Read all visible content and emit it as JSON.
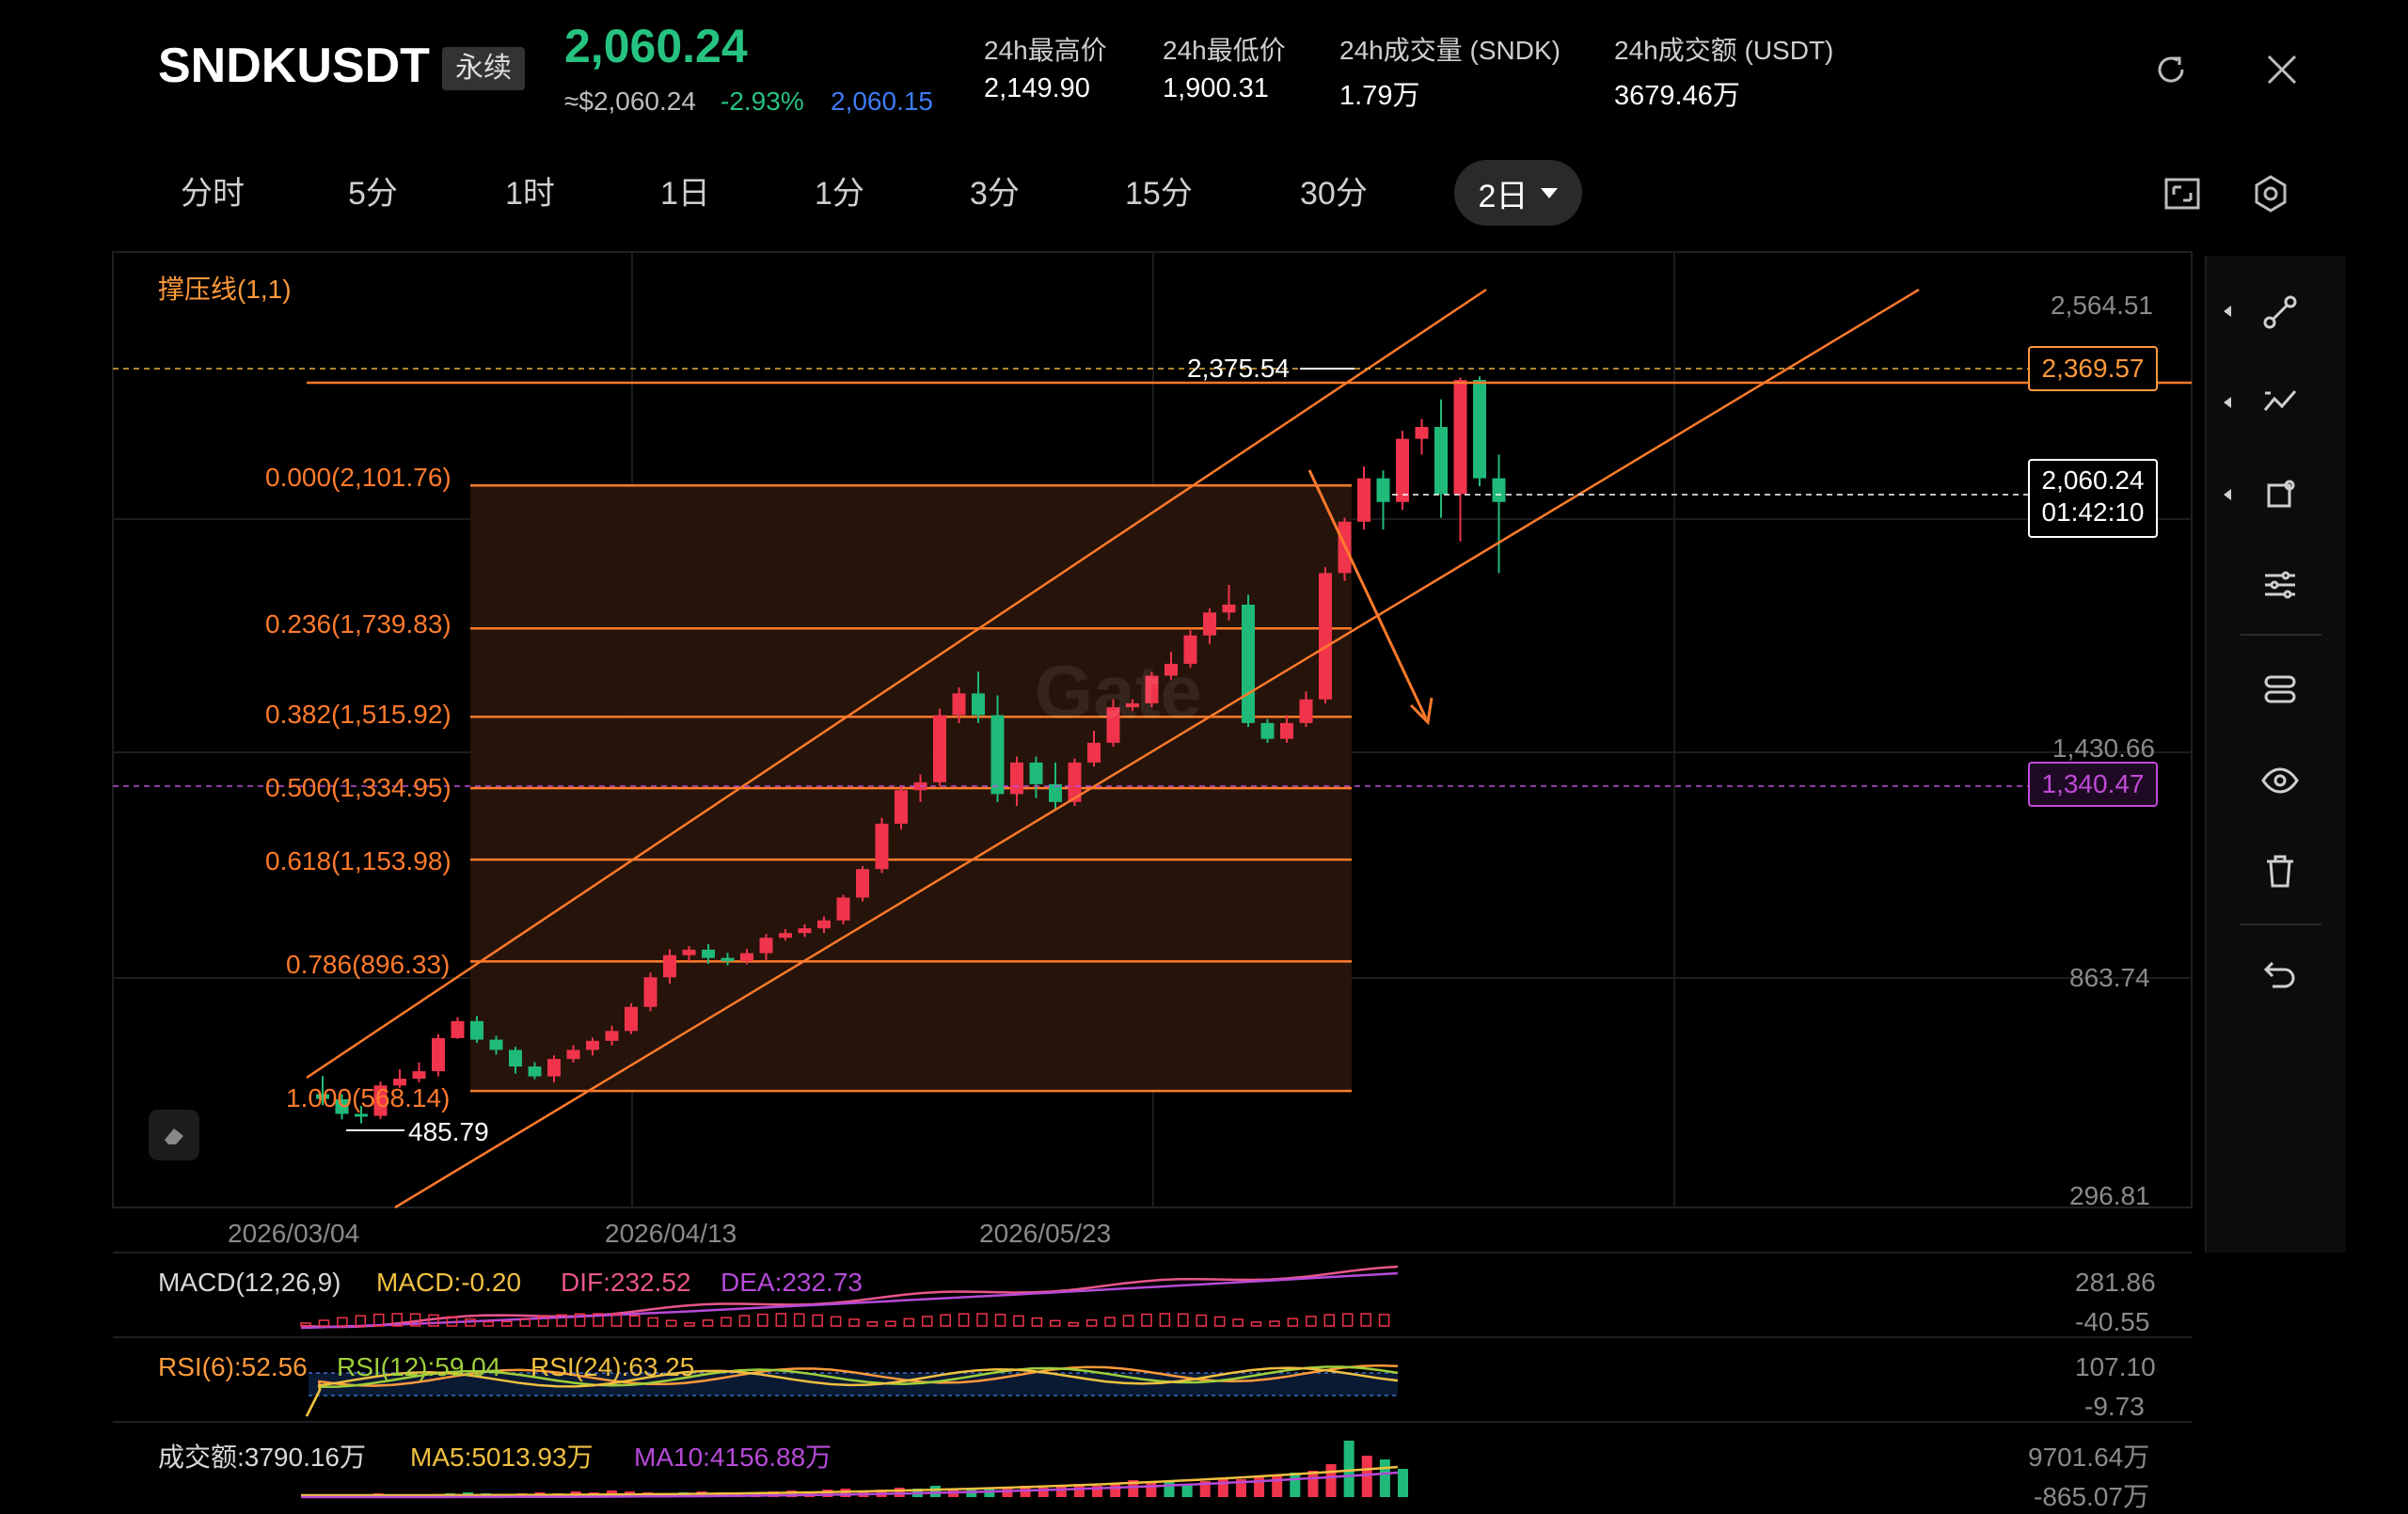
{
  "header": {
    "symbol": "SNDKUSDT",
    "contract_badge": "永续",
    "last_price": "2,060.24",
    "fiat_price": "≈$2,060.24",
    "change_pct": "-2.93%",
    "mark_price": "2,060.15",
    "stats": [
      {
        "label": "24h最高价",
        "value": "2,149.90"
      },
      {
        "label": "24h最低价",
        "value": "1,900.31"
      },
      {
        "label": "24h成交量 (SNDK)",
        "value": "1.79万"
      },
      {
        "label": "24h成交额 (USDT)",
        "value": "3679.46万"
      }
    ]
  },
  "intervals": [
    "分时",
    "5分",
    "1时",
    "1日",
    "1分",
    "3分",
    "15分",
    "30分"
  ],
  "active_interval": "2日",
  "colors": {
    "up": "#f0344c",
    "down": "#1fba7a",
    "fib": "#ff7a2b",
    "magenta": "#c04ad8",
    "price_green": "#26c281",
    "mark_blue": "#3d7cf5",
    "dif": "#e8558c",
    "dea": "#b64ad8",
    "macd_label": "#f0c040",
    "rsi6": "#ff9a3b",
    "rsi12": "#9ecf3b",
    "rsi24": "#f0c040"
  },
  "main_chart": {
    "indicator_label": "撑压线(1,1)",
    "y_ticks": [
      "2,564.51",
      "1,430.66",
      "863.74",
      "296.81"
    ],
    "x_ticks": [
      "2026/03/04",
      "2026/04/13",
      "2026/05/23"
    ],
    "high_marker": "2,375.54",
    "low_marker": "485.79",
    "orange_line_price": "2,369.57",
    "current_price": "2,060.24",
    "countdown": "01:42:10",
    "magenta_line_price": "1,340.47",
    "fib_levels": [
      {
        "label": "0.000(2,101.76)",
        "ratio": 0.0,
        "price": 2101.76
      },
      {
        "label": "0.236(1,739.83)",
        "ratio": 0.236,
        "price": 1739.83
      },
      {
        "label": "0.382(1,515.92)",
        "ratio": 0.382,
        "price": 1515.92
      },
      {
        "label": "0.500(1,334.95)",
        "ratio": 0.5,
        "price": 1334.95
      },
      {
        "label": "0.618(1,153.98)",
        "ratio": 0.618,
        "price": 1153.98
      },
      {
        "label": "0.786(896.33)",
        "ratio": 0.786,
        "price": 896.33
      },
      {
        "label": "1.000(568.14)",
        "ratio": 1.0,
        "price": 568.14
      }
    ],
    "watermark": "Gate"
  },
  "candles": [
    [
      560,
      548,
      606,
      532
    ],
    [
      547,
      510,
      560,
      496
    ],
    [
      510,
      505,
      530,
      486
    ],
    [
      505,
      582,
      592,
      497
    ],
    [
      582,
      599,
      623,
      576
    ],
    [
      599,
      618,
      640,
      590
    ],
    [
      618,
      702,
      712,
      605
    ],
    [
      702,
      745,
      755,
      700
    ],
    [
      745,
      698,
      758,
      690
    ],
    [
      698,
      672,
      708,
      660
    ],
    [
      672,
      630,
      680,
      612
    ],
    [
      630,
      605,
      641,
      598
    ],
    [
      605,
      649,
      658,
      590
    ],
    [
      649,
      672,
      684,
      640
    ],
    [
      672,
      695,
      703,
      658
    ],
    [
      695,
      720,
      733,
      683
    ],
    [
      720,
      781,
      790,
      712
    ],
    [
      781,
      856,
      868,
      770
    ],
    [
      856,
      912,
      927,
      840
    ],
    [
      912,
      926,
      935,
      897
    ],
    [
      926,
      905,
      940,
      890
    ],
    [
      905,
      897,
      918,
      886
    ],
    [
      897,
      917,
      928,
      889
    ],
    [
      917,
      956,
      966,
      900
    ],
    [
      956,
      968,
      978,
      949
    ],
    [
      968,
      980,
      990,
      958
    ],
    [
      980,
      1000,
      1010,
      968
    ],
    [
      1000,
      1058,
      1065,
      990
    ],
    [
      1058,
      1130,
      1138,
      1048
    ],
    [
      1130,
      1245,
      1260,
      1120
    ],
    [
      1245,
      1330,
      1340,
      1230
    ],
    [
      1330,
      1350,
      1370,
      1300
    ],
    [
      1350,
      1520,
      1536,
      1340
    ],
    [
      1520,
      1575,
      1590,
      1500
    ],
    [
      1575,
      1520,
      1630,
      1500
    ],
    [
      1520,
      1320,
      1570,
      1300
    ],
    [
      1320,
      1400,
      1415,
      1290
    ],
    [
      1400,
      1345,
      1415,
      1310
    ],
    [
      1345,
      1300,
      1400,
      1280
    ],
    [
      1300,
      1400,
      1410,
      1290
    ],
    [
      1400,
      1450,
      1480,
      1390
    ],
    [
      1450,
      1540,
      1560,
      1440
    ],
    [
      1540,
      1550,
      1560,
      1530
    ],
    [
      1550,
      1620,
      1630,
      1540
    ],
    [
      1620,
      1650,
      1680,
      1610
    ],
    [
      1650,
      1722,
      1735,
      1640
    ],
    [
      1722,
      1780,
      1790,
      1700
    ],
    [
      1780,
      1800,
      1850,
      1760
    ],
    [
      1800,
      1500,
      1825,
      1490
    ],
    [
      1500,
      1460,
      1510,
      1450
    ],
    [
      1460,
      1500,
      1520,
      1450
    ],
    [
      1500,
      1560,
      1580,
      1490
    ],
    [
      1560,
      1880,
      1895,
      1550
    ],
    [
      1880,
      2010,
      2020,
      1860
    ],
    [
      2010,
      2120,
      2150,
      1990
    ],
    [
      2120,
      2060,
      2140,
      1990
    ],
    [
      2060,
      2220,
      2240,
      2040
    ],
    [
      2220,
      2250,
      2270,
      2180
    ],
    [
      2250,
      2080,
      2320,
      2020
    ],
    [
      2080,
      2369,
      2375,
      1960
    ],
    [
      2369,
      2120,
      2378,
      2100
    ],
    [
      2120,
      2060,
      2180,
      1880
    ]
  ],
  "macd": {
    "label": "MACD(12,26,9)",
    "macd_value": "MACD:-0.20",
    "dif_value": "DIF:232.52",
    "dea_value": "DEA:232.73",
    "y_top": "281.86",
    "y_bottom": "-40.55"
  },
  "rsi": {
    "rsi6": "RSI(6):52.56",
    "rsi12": "RSI(12):59.04",
    "rsi24": "RSI(24):63.25",
    "y_top": "107.10",
    "y_bottom": "-9.73"
  },
  "volume": {
    "label": "成交额:3790.16万",
    "ma5": "MA5:5013.93万",
    "ma10": "MA10:4156.88万",
    "y_top": "9701.64万",
    "y_bottom": "-865.07万"
  },
  "right_tools": [
    "node-line-icon",
    "trend-tool-icon",
    "shape-tool-icon",
    "indicator-settings-icon",
    "layers-icon",
    "eye-icon",
    "trash-icon",
    "undo-icon"
  ]
}
